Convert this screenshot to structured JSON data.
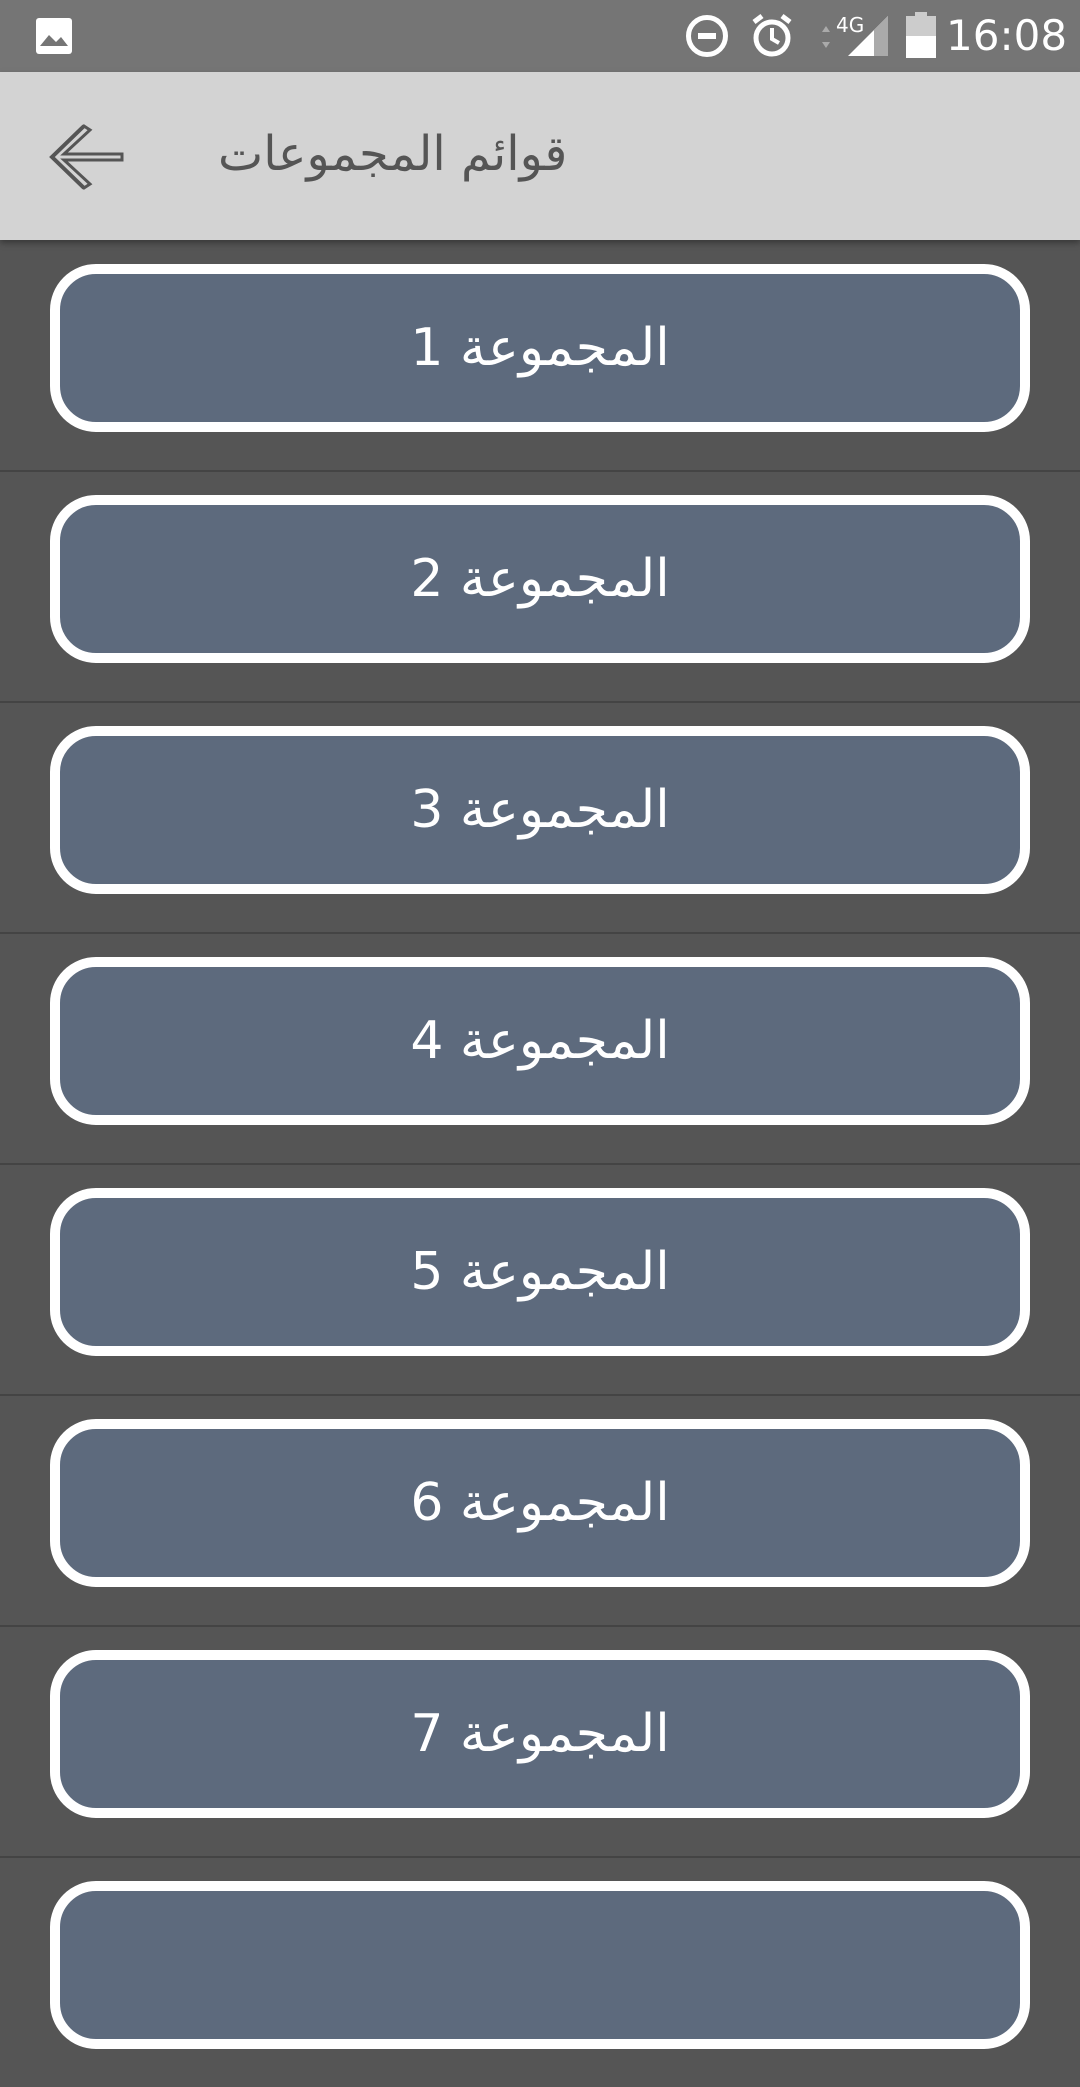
{
  "status_bar": {
    "network": "4G",
    "time": "16:08",
    "icons": [
      "image-notification-icon",
      "do-not-disturb-icon",
      "alarm-icon",
      "signal-icon",
      "battery-icon"
    ]
  },
  "app_bar": {
    "title": "قوائم المجموعات",
    "back_icon": "arrow-back-icon",
    "background": "#d3d3d3"
  },
  "groups": [
    {
      "label": "المجموعة 1"
    },
    {
      "label": "المجموعة 2"
    },
    {
      "label": "المجموعة 3"
    },
    {
      "label": "المجموعة 4"
    },
    {
      "label": "المجموعة 5"
    },
    {
      "label": "المجموعة 6"
    },
    {
      "label": "المجموعة 7"
    },
    {
      "label": ""
    }
  ],
  "colors": {
    "list_background": "#555555",
    "button_fill": "#5d6a7d",
    "button_border": "#ffffff",
    "status_bar": "#757575"
  }
}
